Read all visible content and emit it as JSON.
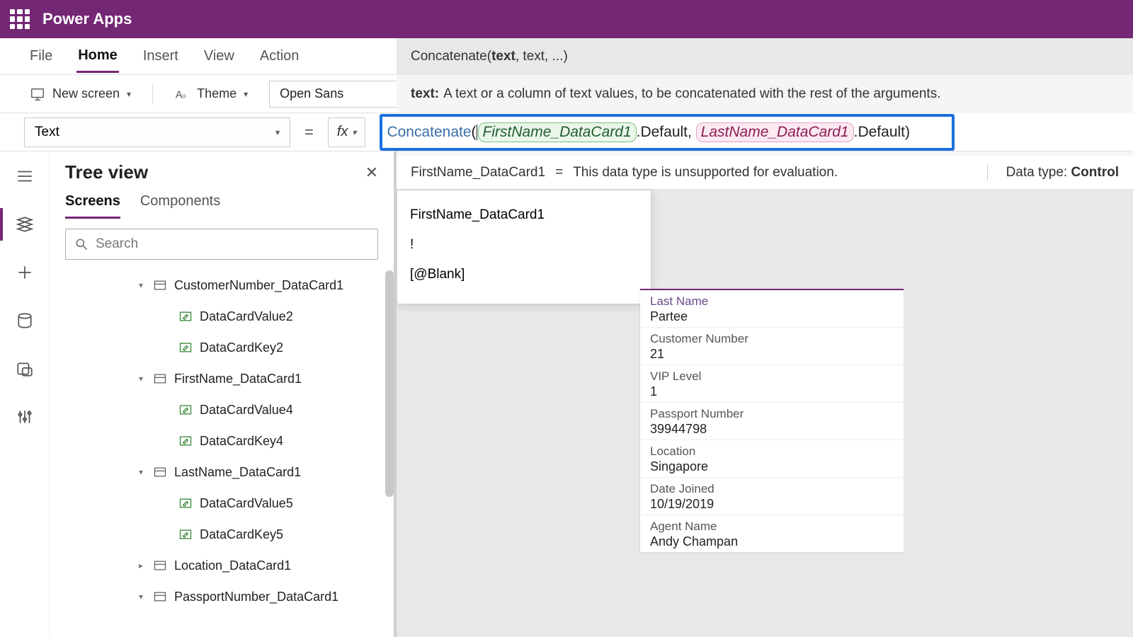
{
  "titlebar": {
    "app_name": "Power Apps"
  },
  "menubar": {
    "file": "File",
    "home": "Home",
    "insert": "Insert",
    "view": "View",
    "action": "Action",
    "signature": {
      "fn": "Concatenate(",
      "bold_arg": "text",
      "rest": ", text, ...)"
    }
  },
  "toolbar": {
    "new_screen": "New screen",
    "theme": "Theme",
    "font": "Open Sans",
    "param": {
      "name": "text:",
      "desc": "A text or a column of text values, to be concatenated with the rest of the arguments."
    }
  },
  "formula": {
    "property": "Text",
    "fx": "fx",
    "tokens": {
      "fn": "Concatenate",
      "open": "(",
      "ref1": "FirstName_DataCard1",
      "dotdef": ".Default",
      "comma": ", ",
      "ref2": "LastName_DataCard1",
      "close": ")"
    }
  },
  "eval": {
    "lhs": "FirstName_DataCard1",
    "eq": "=",
    "msg": "This data type is unsupported for evaluation.",
    "dtype_label": "Data type:",
    "dtype_value": "Control"
  },
  "suggest": {
    "s1": "FirstName_DataCard1",
    "s2": "!",
    "s3": "[@Blank]"
  },
  "tree": {
    "title": "Tree view",
    "tab_screens": "Screens",
    "tab_components": "Components",
    "search_placeholder": "Search",
    "items": {
      "custnum": "CustomerNumber_DataCard1",
      "dcv2": "DataCardValue2",
      "dck2": "DataCardKey2",
      "firstname": "FirstName_DataCard1",
      "dcv4": "DataCardValue4",
      "dck4": "DataCardKey4",
      "lastname": "LastName_DataCard1",
      "dcv5": "DataCardValue5",
      "dck5": "DataCardKey5",
      "location": "Location_DataCard1",
      "passport": "PassportNumber_DataCard1"
    }
  },
  "form": {
    "f1": {
      "lbl": "Last Name",
      "val": "Partee"
    },
    "f2": {
      "lbl": "Customer Number",
      "val": "21"
    },
    "f3": {
      "lbl": "VIP Level",
      "val": "1"
    },
    "f4": {
      "lbl": "Passport Number",
      "val": "39944798"
    },
    "f5": {
      "lbl": "Location",
      "val": "Singapore"
    },
    "f6": {
      "lbl": "Date Joined",
      "val": "10/19/2019"
    },
    "f7": {
      "lbl": "Agent Name",
      "val": "Andy Champan"
    }
  }
}
